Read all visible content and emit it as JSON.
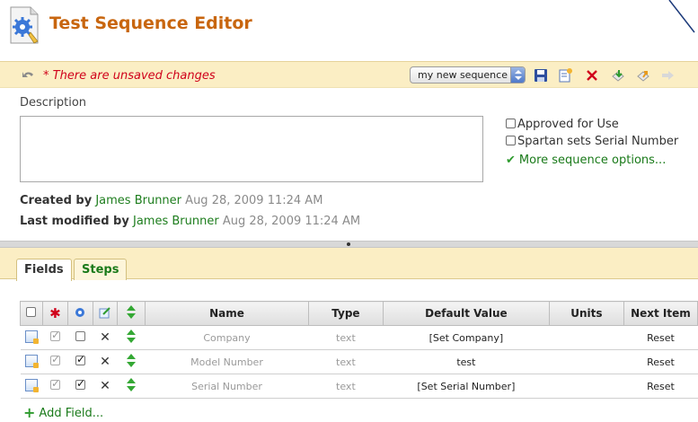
{
  "header": {
    "title": "Test Sequence Editor"
  },
  "toolbar": {
    "unsaved_text": "* There are unsaved changes",
    "sequence_selected": "my new sequence"
  },
  "description": {
    "label": "Description",
    "value": ""
  },
  "options": {
    "approved_label": "Approved for Use",
    "spartan_label": "Spartan sets Serial Number",
    "more_label": "More sequence options..."
  },
  "meta": {
    "created_prefix": "Created by",
    "created_by": "James Brunner",
    "created_at": "Aug 28, 2009 11:24 AM",
    "modified_prefix": "Last modified by",
    "modified_by": "James Brunner",
    "modified_at": "Aug 28, 2009 11:24 AM"
  },
  "tabs": [
    {
      "label": "Fields",
      "active": true
    },
    {
      "label": "Steps",
      "active": false
    }
  ],
  "table": {
    "columns": [
      "Name",
      "Type",
      "Default Value",
      "Units",
      "Next Item"
    ],
    "rows": [
      {
        "name": "Company",
        "type": "text",
        "default": "[Set Company]",
        "units": "",
        "next": "Reset",
        "checked": false
      },
      {
        "name": "Model Number",
        "type": "text",
        "default": "test",
        "units": "",
        "next": "Reset",
        "checked": true
      },
      {
        "name": "Serial Number",
        "type": "text",
        "default": "[Set Serial Number]",
        "units": "",
        "next": "Reset",
        "checked": true
      }
    ]
  },
  "add_field": "Add Field...",
  "colors": {
    "title": "#c8660f",
    "toolbar_bg": "#fbeec4",
    "link_green": "#1a7a1a",
    "warning_red": "#d0021b"
  }
}
